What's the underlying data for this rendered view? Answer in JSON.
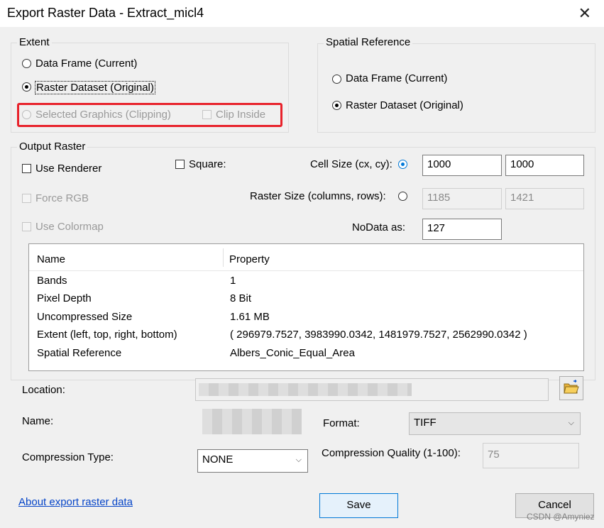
{
  "window": {
    "title": "Export Raster Data - Extract_micl4",
    "close_glyph": "✕"
  },
  "extent": {
    "label": "Extent",
    "data_frame": "Data Frame (Current)",
    "raster_dataset": "Raster Dataset (Original)",
    "selected_graphics": "Selected Graphics (Clipping)",
    "clip_inside": "Clip Inside"
  },
  "spatial_reference": {
    "label": "Spatial Reference",
    "data_frame": "Data Frame (Current)",
    "raster_dataset": "Raster Dataset (Original)"
  },
  "output_raster": {
    "label": "Output Raster",
    "use_renderer": "Use Renderer",
    "square": "Square:",
    "force_rgb": "Force RGB",
    "use_colormap": "Use Colormap",
    "cell_size_label": "Cell Size (cx, cy):",
    "cell_size_cx": "1000",
    "cell_size_cy": "1000",
    "raster_size_label": "Raster Size (columns, rows):",
    "raster_columns": "1185",
    "raster_rows": "1421",
    "nodata_label": "NoData as:",
    "nodata_value": "127"
  },
  "properties": {
    "headers": [
      "Name",
      "Property"
    ],
    "rows": [
      [
        "Bands",
        "1"
      ],
      [
        "Pixel Depth",
        "8 Bit"
      ],
      [
        "Uncompressed Size",
        "1.61 MB"
      ],
      [
        "Extent (left, top, right, bottom)",
        "( 296979.7527, 3983990.0342, 1481979.7527, 2562990.0342 )"
      ],
      [
        "Spatial Reference",
        "Albers_Conic_Equal_Area"
      ]
    ]
  },
  "location_label": "Location:",
  "name_label": "Name:",
  "format_label": "Format:",
  "format_value": "TIFF",
  "compression_type_label": "Compression Type:",
  "compression_type_value": "NONE",
  "compression_quality_label": "Compression Quality (1-100):",
  "compression_quality_value": "75",
  "about_link": "About export raster data",
  "save_button": "Save",
  "cancel_button": "Cancel",
  "watermark": "CSDN @Amyniez",
  "accent_color": "#0078d7",
  "highlight_color": "#e8222b"
}
